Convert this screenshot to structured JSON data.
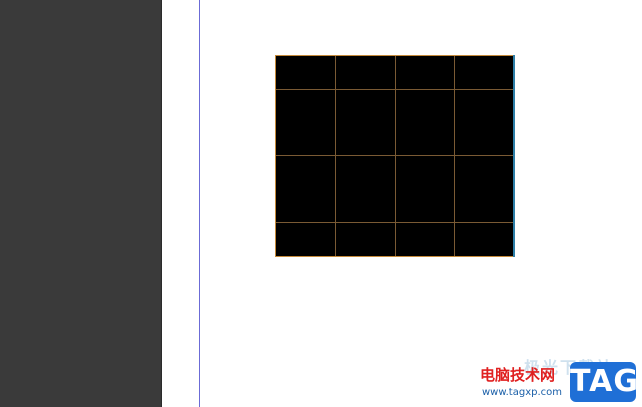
{
  "table": {
    "rows": 4,
    "columns": 4
  },
  "colors": {
    "side_panel": "#3a3a3a",
    "canvas": "#ffffff",
    "table_fill": "#000000",
    "table_border": "#c58a3b",
    "margin_guide": "#6b6bd6"
  },
  "watermark": {
    "faded_text": "极光下载站",
    "title": "电脑技术网",
    "url": "www.tagxp.com",
    "badge": "TAG"
  }
}
